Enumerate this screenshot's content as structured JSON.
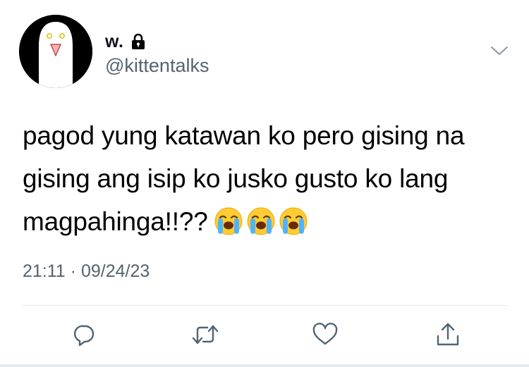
{
  "user": {
    "display_name": "w.",
    "handle": "@kittentalks",
    "verified_lock": "lock-icon",
    "avatar": "ghost-avatar"
  },
  "tweet": {
    "text": "pagod yung katawan ko pero gising na gising ang isip ko jusko gusto ko lang magpahinga!!??",
    "emojis": [
      "loudly-crying-face",
      "loudly-crying-face",
      "loudly-crying-face"
    ],
    "time": "21:11",
    "separator": "·",
    "date": "09/24/23"
  },
  "actions": [
    {
      "name": "reply",
      "icon": "reply-icon"
    },
    {
      "name": "retweet",
      "icon": "retweet-icon"
    },
    {
      "name": "like",
      "icon": "heart-icon"
    },
    {
      "name": "share",
      "icon": "share-icon"
    }
  ],
  "colors": {
    "text": "#000000",
    "secondary": "#536471",
    "icon": "#536471",
    "divider": "#e1e6ea"
  }
}
